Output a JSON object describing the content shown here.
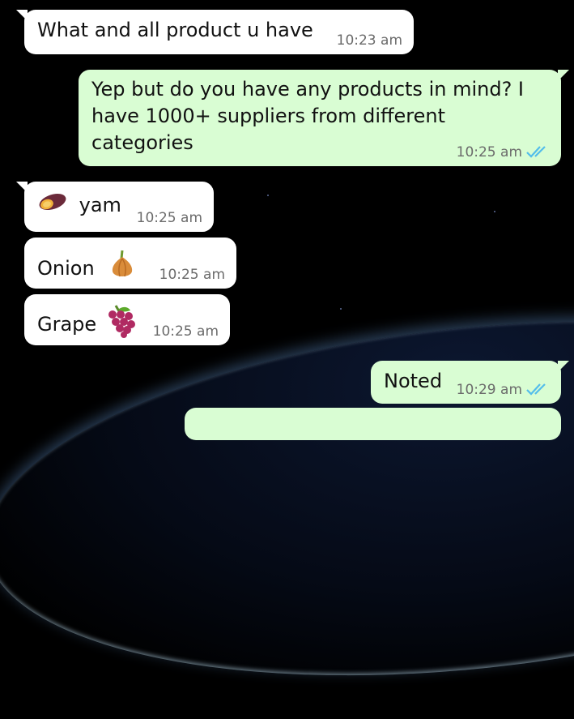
{
  "messages": [
    {
      "text": "What and all product u have",
      "time": "10:23 am"
    },
    {
      "text": "Yep but do you have any products in mind? I have 1000+ suppliers from different categories",
      "time": "10:25 am"
    },
    {
      "text": "yam",
      "time": "10:25 am",
      "emoji": "sweet-potato-icon"
    },
    {
      "text": "Onion",
      "time": "10:25 am",
      "emoji": "onion-icon"
    },
    {
      "text": "Grape",
      "time": "10:25 am",
      "emoji": "grapes-icon"
    },
    {
      "text": "Noted",
      "time": "10:29 am"
    }
  ],
  "colors": {
    "incoming_bubble": "#ffffff",
    "outgoing_bubble": "#d9fdd3",
    "read_ticks": "#53bdeb"
  }
}
